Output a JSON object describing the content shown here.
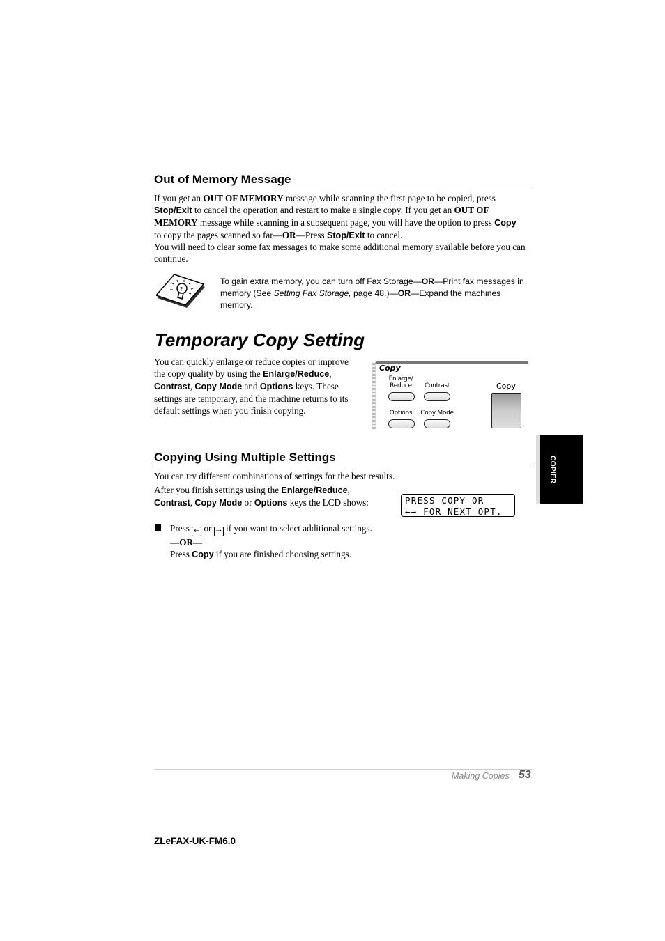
{
  "out_of_memory": {
    "heading": "Out of Memory Message",
    "p1": {
      "t1": "If you get an ",
      "b1": "OUT OF MEMORY",
      "t2": " message while scanning the first page to be copied, press",
      "k1": "Stop/Exit",
      "t3": " to cancel the operation and restart to make a single copy. If you get an ",
      "b2": "OUT OF",
      "b3": "MEMORY",
      "t4": " message while scanning in a subsequent page, you will have the option to press ",
      "k2": "Copy",
      "t5": "to copy the pages scanned so far—",
      "b4": "OR",
      "t6": "—Press ",
      "k3": "Stop/Exit",
      "t7": " to cancel."
    },
    "p2": "You will need to clear some fax messages to make some additional memory available before you can continue.",
    "note": {
      "icon": "lightbulb-note-icon",
      "t1": "To gain extra memory, you can turn off Fax Storage—",
      "b1": "OR",
      "t2": "—Print fax messages in memory (See ",
      "i1": "Setting Fax Storage,",
      "t3": " page 48.)—",
      "b2": "OR",
      "t4": "—Expand the machines memory."
    }
  },
  "temporary_copy": {
    "heading": "Temporary Copy Setting",
    "p1": {
      "t1": "You can quickly enlarge or reduce copies or improve the copy quality by using the ",
      "k1": "Enlarge/Reduce",
      "t2": ",",
      "k2": "Contrast",
      "t3": ", ",
      "k3": "Copy Mode",
      "t4": " and ",
      "k4": "Options",
      "t5": " keys. These settings are temporary, and the machine returns to its default settings when you finish copying."
    },
    "panel": {
      "title": "Copy",
      "keys": [
        {
          "label_l1": "Enlarge/",
          "label_l2": "Reduce"
        },
        {
          "label_l1": "Contrast"
        },
        {
          "label_l1": "Options"
        },
        {
          "label_l1": "Copy Mode"
        }
      ],
      "copy_key_label": "Copy"
    }
  },
  "multiple_settings": {
    "heading": "Copying Using Multiple Settings",
    "p1": "You can try different combinations of settings for the best results.",
    "p2": {
      "t1": "After you finish settings using the ",
      "k1": "Enlarge/Reduce",
      "t2": ",",
      "k2": "Contrast",
      "t3": ", ",
      "k3": "Copy Mode",
      "t4": " or ",
      "k4": "Options",
      "t5": " keys the LCD shows:"
    },
    "lcd": {
      "line1": "PRESS COPY OR",
      "line2": "←→ FOR NEXT OPT."
    },
    "bullet": {
      "t1": "Press ",
      "left_icon": "←",
      "t2": " or ",
      "right_icon": "→",
      "t3": " if you want to select additional settings.",
      "or": "—OR—",
      "t4": "Press ",
      "k1": "Copy",
      "t5": " if you are finished choosing settings."
    }
  },
  "side_tab": "COPIER",
  "footer": {
    "section": "Making Copies",
    "page": "53",
    "doc_id": "ZLeFAX-UK-FM6.0"
  }
}
